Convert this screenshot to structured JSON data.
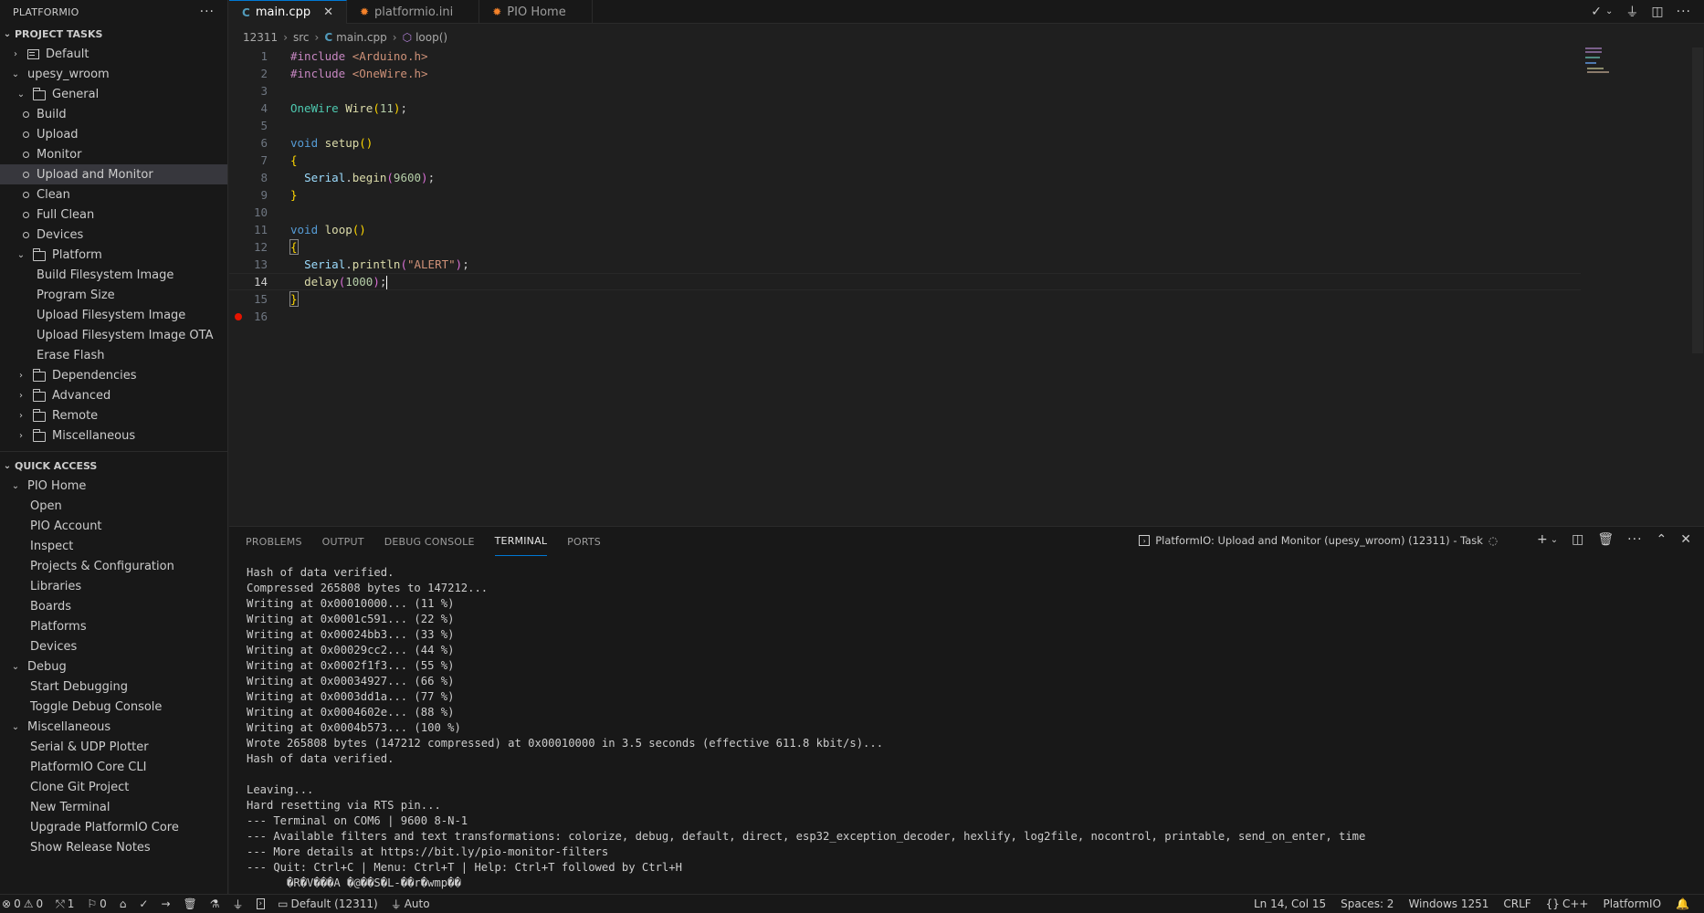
{
  "sidebar": {
    "title": "PLATFORMIO",
    "project_tasks": {
      "label": "PROJECT TASKS",
      "items": [
        {
          "label": "Default",
          "indent": 1,
          "kind": "project",
          "chevron": "right"
        },
        {
          "label": "upesy_wroom",
          "indent": 1,
          "kind": "none",
          "chevron": "down"
        },
        {
          "label": "General",
          "indent": 2,
          "kind": "folder",
          "chevron": "down"
        },
        {
          "label": "Build",
          "indent": 3,
          "kind": "circle"
        },
        {
          "label": "Upload",
          "indent": 3,
          "kind": "circle"
        },
        {
          "label": "Monitor",
          "indent": 3,
          "kind": "circle"
        },
        {
          "label": "Upload and Monitor",
          "indent": 3,
          "kind": "circle",
          "selected": true
        },
        {
          "label": "Clean",
          "indent": 3,
          "kind": "circle"
        },
        {
          "label": "Full Clean",
          "indent": 3,
          "kind": "circle"
        },
        {
          "label": "Devices",
          "indent": 3,
          "kind": "circle"
        },
        {
          "label": "Platform",
          "indent": 2,
          "kind": "folder",
          "chevron": "down"
        },
        {
          "label": "Build Filesystem Image",
          "indent": 4,
          "kind": "none"
        },
        {
          "label": "Program Size",
          "indent": 4,
          "kind": "none"
        },
        {
          "label": "Upload Filesystem Image",
          "indent": 4,
          "kind": "none"
        },
        {
          "label": "Upload Filesystem Image OTA",
          "indent": 4,
          "kind": "none"
        },
        {
          "label": "Erase Flash",
          "indent": 4,
          "kind": "none"
        },
        {
          "label": "Dependencies",
          "indent": 2,
          "kind": "folder",
          "chevron": "right"
        },
        {
          "label": "Advanced",
          "indent": 2,
          "kind": "folder",
          "chevron": "right"
        },
        {
          "label": "Remote",
          "indent": 2,
          "kind": "folder",
          "chevron": "right"
        },
        {
          "label": "Miscellaneous",
          "indent": 2,
          "kind": "folder",
          "chevron": "right"
        }
      ]
    },
    "quick_access": {
      "label": "QUICK ACCESS",
      "items": [
        {
          "label": "PIO Home",
          "indent": 1,
          "kind": "none",
          "chevron": "down"
        },
        {
          "label": "Open",
          "indent": 5,
          "kind": "none"
        },
        {
          "label": "PIO Account",
          "indent": 5,
          "kind": "none"
        },
        {
          "label": "Inspect",
          "indent": 5,
          "kind": "none"
        },
        {
          "label": "Projects & Configuration",
          "indent": 5,
          "kind": "none"
        },
        {
          "label": "Libraries",
          "indent": 5,
          "kind": "none"
        },
        {
          "label": "Boards",
          "indent": 5,
          "kind": "none"
        },
        {
          "label": "Platforms",
          "indent": 5,
          "kind": "none"
        },
        {
          "label": "Devices",
          "indent": 5,
          "kind": "none"
        },
        {
          "label": "Debug",
          "indent": 1,
          "kind": "none",
          "chevron": "down"
        },
        {
          "label": "Start Debugging",
          "indent": 5,
          "kind": "none"
        },
        {
          "label": "Toggle Debug Console",
          "indent": 5,
          "kind": "none"
        },
        {
          "label": "Miscellaneous",
          "indent": 1,
          "kind": "none",
          "chevron": "down"
        },
        {
          "label": "Serial & UDP Plotter",
          "indent": 5,
          "kind": "none"
        },
        {
          "label": "PlatformIO Core CLI",
          "indent": 5,
          "kind": "none"
        },
        {
          "label": "Clone Git Project",
          "indent": 5,
          "kind": "none"
        },
        {
          "label": "New Terminal",
          "indent": 5,
          "kind": "none"
        },
        {
          "label": "Upgrade PlatformIO Core",
          "indent": 5,
          "kind": "none"
        },
        {
          "label": "Show Release Notes",
          "indent": 5,
          "kind": "none"
        }
      ]
    }
  },
  "tabs": [
    {
      "label": "main.cpp",
      "icon": "C",
      "icon_color": "#519aba",
      "active": true
    },
    {
      "label": "platformio.ini",
      "icon": "✹",
      "icon_color": "#f5822a",
      "active": false
    },
    {
      "label": "PIO Home",
      "icon": "✹",
      "icon_color": "#f5822a",
      "active": false
    }
  ],
  "breadcrumb": {
    "parts": [
      "12311",
      "src",
      "main.cpp",
      "loop()"
    ]
  },
  "editor": {
    "current_line": 14,
    "breakpoint_line": 16,
    "lines": [
      {
        "n": "1",
        "html": "<span class='pp'>#include</span> <span class='inc'>&lt;Arduino.h&gt;</span>"
      },
      {
        "n": "2",
        "html": "<span class='pp'>#include</span> <span class='inc'>&lt;OneWire.h&gt;</span>"
      },
      {
        "n": "3",
        "html": ""
      },
      {
        "n": "4",
        "html": "<span class='ty'>OneWire</span> <span class='fn'>Wire</span><span class='br'>(</span><span class='num'>11</span><span class='br'>)</span>;"
      },
      {
        "n": "5",
        "html": ""
      },
      {
        "n": "6",
        "html": "<span class='kw'>void</span> <span class='fn'>setup</span><span class='br'>()</span>"
      },
      {
        "n": "7",
        "html": "<span class='br'>{</span>"
      },
      {
        "n": "8",
        "html": "  <span class='var'>Serial</span>.<span class='fn'>begin</span><span class='br' style='color:#da70d6'>(</span><span class='num'>9600</span><span class='br' style='color:#da70d6'>)</span>;"
      },
      {
        "n": "9",
        "html": "<span class='br'>}</span>"
      },
      {
        "n": "10",
        "html": ""
      },
      {
        "n": "11",
        "html": "<span class='kw'>void</span> <span class='fn'>loop</span><span class='br'>()</span>"
      },
      {
        "n": "12",
        "html": "<span class='br' style='outline:1px solid #888'>{</span>"
      },
      {
        "n": "13",
        "html": "  <span class='var'>Serial</span>.<span class='fn'>println</span><span class='br' style='color:#da70d6'>(</span><span class='str'>\"ALERT\"</span><span class='br' style='color:#da70d6'>)</span>;"
      },
      {
        "n": "14",
        "html": "  <span class='fn'>delay</span><span class='br' style='color:#da70d6'>(</span><span class='num'>1000</span><span class='br' style='color:#da70d6'>)</span>;<span class='cursor'></span>"
      },
      {
        "n": "15",
        "html": "<span class='br' style='outline:1px solid #888'>}</span>"
      },
      {
        "n": "16",
        "html": ""
      }
    ]
  },
  "panel": {
    "tabs": [
      {
        "label": "PROBLEMS",
        "active": false
      },
      {
        "label": "OUTPUT",
        "active": false
      },
      {
        "label": "DEBUG CONSOLE",
        "active": false
      },
      {
        "label": "TERMINAL",
        "active": true
      },
      {
        "label": "PORTS",
        "active": false
      }
    ],
    "task_label": "PlatformIO: Upload and Monitor (upesy_wroom) (12311) - Task",
    "terminal_lines": [
      "Hash of data verified.",
      "Compressed 265808 bytes to 147212...",
      "Writing at 0x00010000... (11 %)",
      "Writing at 0x0001c591... (22 %)",
      "Writing at 0x00024bb3... (33 %)",
      "Writing at 0x00029cc2... (44 %)",
      "Writing at 0x0002f1f3... (55 %)",
      "Writing at 0x00034927... (66 %)",
      "Writing at 0x0003dd1a... (77 %)",
      "Writing at 0x0004602e... (88 %)",
      "Writing at 0x0004b573... (100 %)",
      "Wrote 265808 bytes (147212 compressed) at 0x00010000 in 3.5 seconds (effective 611.8 kbit/s)...",
      "Hash of data verified.",
      "",
      "Leaving...",
      "Hard resetting via RTS pin...",
      "--- Terminal on COM6 | 9600 8-N-1",
      "--- Available filters and text transformations: colorize, debug, default, direct, esp32_exception_decoder, hexlify, log2file, nocontrol, printable, send_on_enter, time",
      "--- More details at https://bit.ly/pio-monitor-filters",
      "--- Quit: Ctrl+C | Menu: Ctrl+T | Help: Ctrl+T followed by Ctrl+H",
      "      �R�V���A �@��S�L-��r�wmp��"
    ]
  },
  "statusbar": {
    "errors": "0",
    "warnings": "0",
    "ports": "1",
    "info": "0",
    "env": "Default (12311)",
    "auto": "Auto",
    "position": "Ln 14, Col 15",
    "spaces": "Spaces: 2",
    "encoding": "Windows 1251",
    "eol": "CRLF",
    "language": "C++",
    "platform": "PlatformIO"
  }
}
